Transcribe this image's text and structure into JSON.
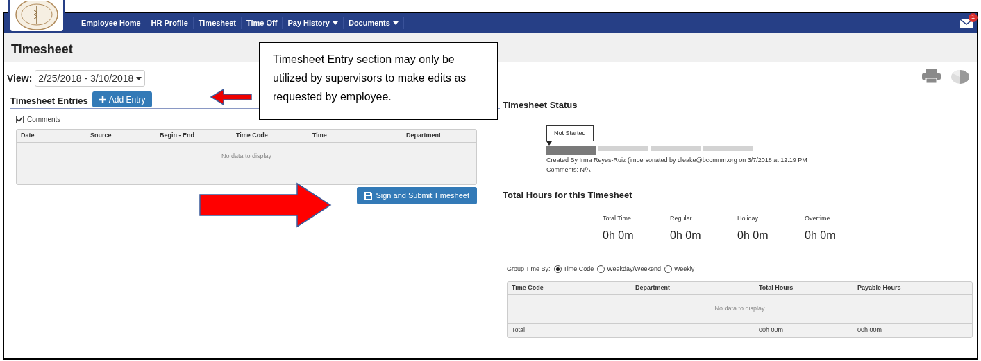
{
  "nav": {
    "items": [
      {
        "label": "Employee Home",
        "dropdown": false
      },
      {
        "label": "HR Profile",
        "dropdown": false
      },
      {
        "label": "Timesheet",
        "dropdown": false
      },
      {
        "label": "Time Off",
        "dropdown": false
      },
      {
        "label": "Pay History",
        "dropdown": true
      },
      {
        "label": "Documents",
        "dropdown": true
      }
    ],
    "mail_badge": "1"
  },
  "page_title": "Timesheet",
  "view": {
    "label": "View:",
    "value": "2/25/2018 - 3/10/2018"
  },
  "entries": {
    "title": "Timesheet Entries",
    "add_button": "Add Entry",
    "comments": {
      "label": "Comments",
      "checked": true
    },
    "columns": [
      "Date",
      "Source",
      "Begin - End",
      "Time Code",
      "Time",
      "Department"
    ],
    "empty": "No data to display",
    "submit_button": "Sign and Submit Timesheet"
  },
  "callout": "Timesheet Entry section may only be utilized by supervisors to make edits as requested by employee.",
  "status": {
    "title": "Timesheet Status",
    "tooltip": "Not Started",
    "steps": [
      {
        "done": true
      },
      {
        "done": false
      },
      {
        "done": false
      },
      {
        "done": false
      }
    ],
    "created": "Created By Irma Reyes-Ruiz (impersonated by dleake@bcomnm.org on 3/7/2018 at 12:19 PM",
    "comments": "Comments: N/A"
  },
  "totals": {
    "title": "Total Hours for this Timesheet",
    "stats": [
      {
        "label": "Total Time",
        "value": "0h 0m"
      },
      {
        "label": "Regular",
        "value": "0h 0m"
      },
      {
        "label": "Holiday",
        "value": "0h 0m"
      },
      {
        "label": "Overtime",
        "value": "0h 0m"
      }
    ]
  },
  "group_by": {
    "label": "Group Time By:",
    "options": [
      {
        "label": "Time Code",
        "selected": true
      },
      {
        "label": "Weekday/Weekend",
        "selected": false
      },
      {
        "label": "Weekly",
        "selected": false
      }
    ]
  },
  "summary": {
    "columns": [
      "Time Code",
      "Department",
      "Total Hours",
      "Payable Hours"
    ],
    "empty": "No data to display",
    "total_row": {
      "label": "Total",
      "total_hours": "00h 00m",
      "payable_hours": "00h 00m"
    }
  }
}
